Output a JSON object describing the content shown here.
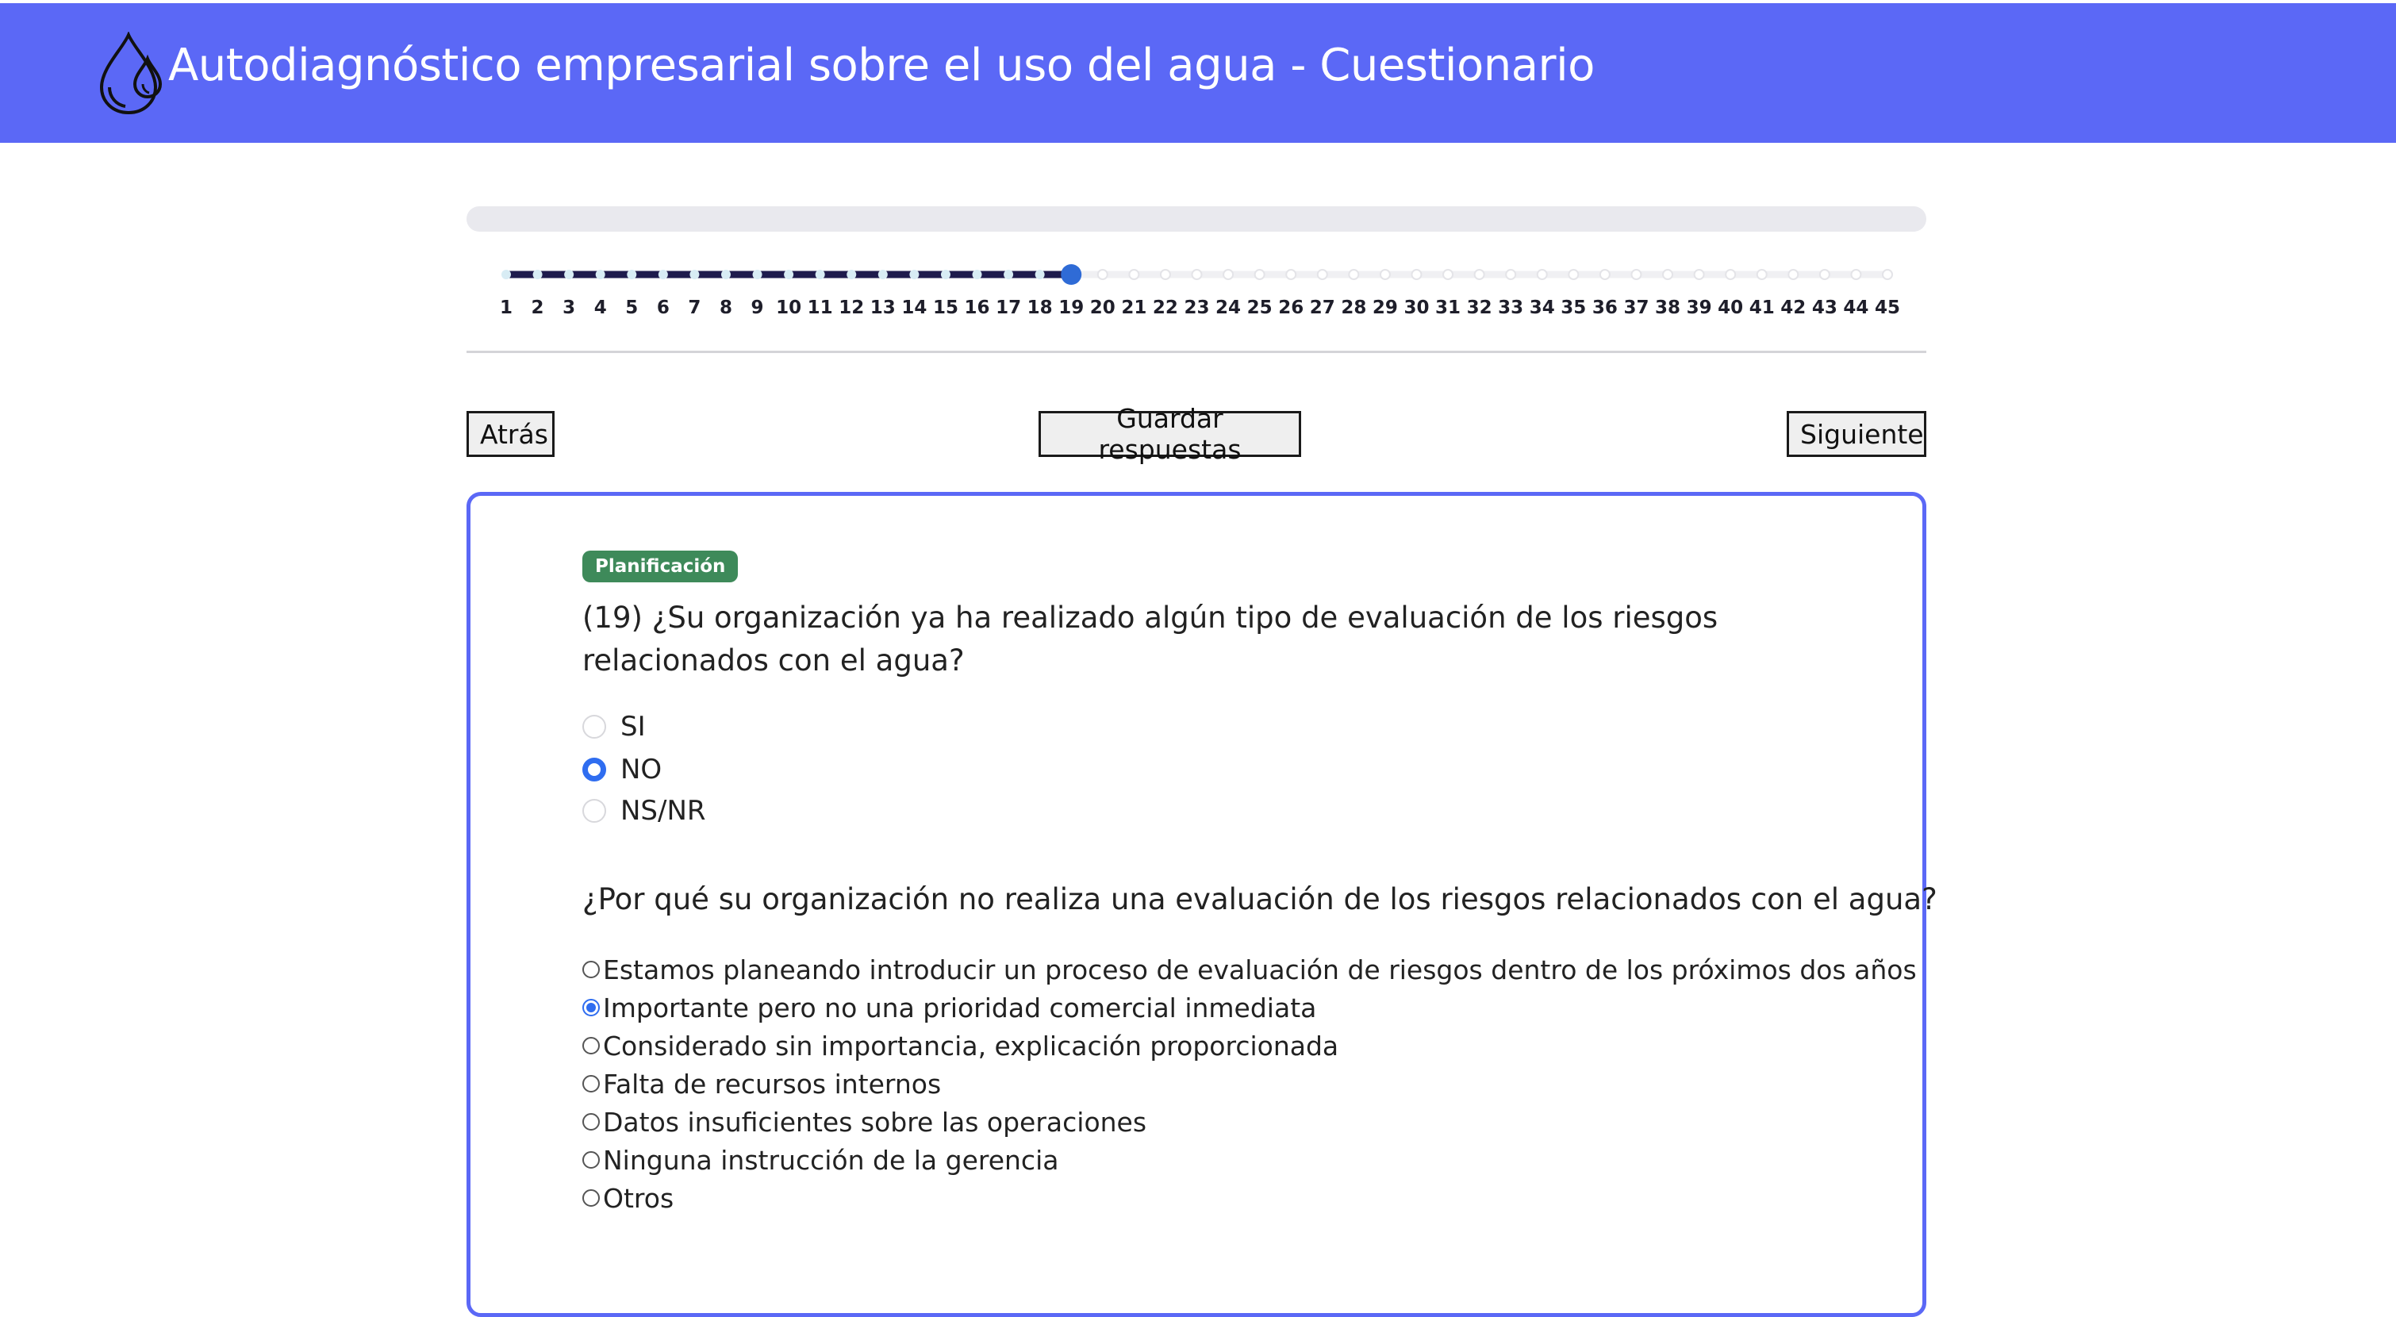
{
  "header": {
    "title": "Autodiagnóstico empresarial sobre el uso del agua - Cuestionario",
    "logo_icon": "water-drops-icon"
  },
  "progress": {
    "total_steps": 45,
    "current_step": 19,
    "steps": [
      "1",
      "2",
      "3",
      "4",
      "5",
      "6",
      "7",
      "8",
      "9",
      "10",
      "11",
      "12",
      "13",
      "14",
      "15",
      "16",
      "17",
      "18",
      "19",
      "20",
      "21",
      "22",
      "23",
      "24",
      "25",
      "26",
      "27",
      "28",
      "29",
      "30",
      "31",
      "32",
      "33",
      "34",
      "35",
      "36",
      "37",
      "38",
      "39",
      "40",
      "41",
      "42",
      "43",
      "44",
      "45"
    ],
    "colors": {
      "done_line": "#1f1b4d",
      "pending_line": "#f0f0f3",
      "current_dot": "#2f6bd6",
      "done_dot": "#d8ecf4"
    }
  },
  "nav": {
    "back_label": "Atrás",
    "save_label": "Guardar respuestas",
    "next_label": "Siguiente"
  },
  "question": {
    "category": "Planificación",
    "category_color": "#3e8a5a",
    "text": "(19) ¿Su organización ya ha realizado algún tipo de evaluación de los riesgos relacionados con el agua?",
    "options": [
      {
        "label": "SI",
        "checked": false
      },
      {
        "label": "NO",
        "checked": true
      },
      {
        "label": "NS/NR",
        "checked": false
      }
    ]
  },
  "followup": {
    "text": "¿Por qué su organización no realiza una evaluación de los riesgos relacionados con el agua?",
    "options": [
      {
        "label": "Estamos planeando introducir un proceso de evaluación de riesgos dentro de los próximos dos años",
        "checked": false
      },
      {
        "label": "Importante pero no una prioridad comercial inmediata",
        "checked": true
      },
      {
        "label": "Considerado sin importancia, explicación proporcionada",
        "checked": false
      },
      {
        "label": "Falta de recursos internos",
        "checked": false
      },
      {
        "label": "Datos insuficientes sobre las operaciones",
        "checked": false
      },
      {
        "label": "Ninguna instrucción de la gerencia",
        "checked": false
      },
      {
        "label": "Otros",
        "checked": false
      }
    ]
  },
  "accent_color": "#5b68f6"
}
